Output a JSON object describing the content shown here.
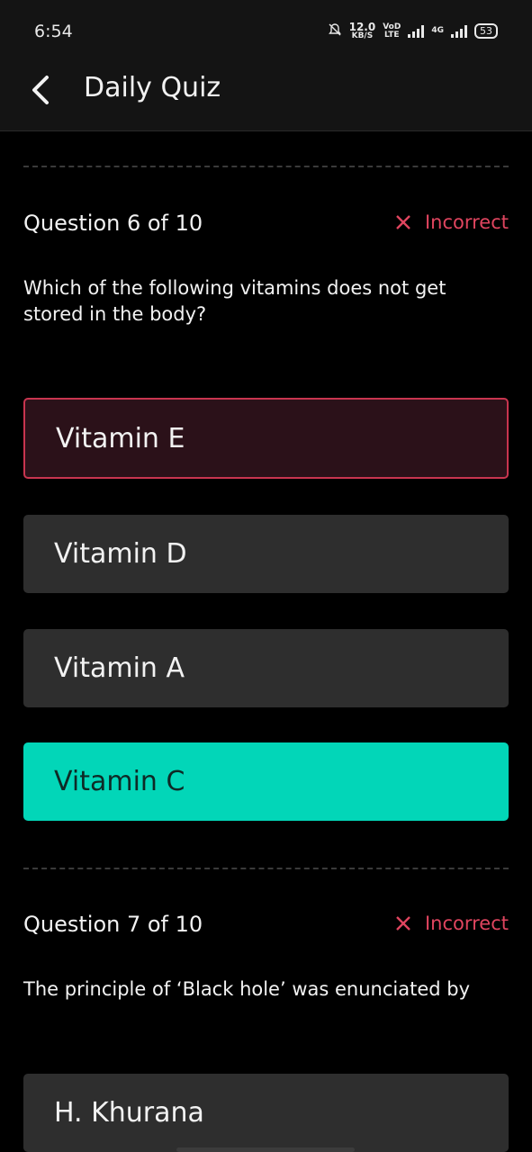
{
  "status_bar": {
    "time": "6:54",
    "net_speed_value": "12.0",
    "net_speed_unit": "KB/S",
    "carrier_top": "VoD",
    "carrier_bottom": "LTE",
    "network_type": "4G",
    "battery": "53"
  },
  "header": {
    "title": "Daily Quiz"
  },
  "questions": [
    {
      "number_label": "Question 6 of 10",
      "status": "Incorrect",
      "text": "Which of the following vitamins does not get stored in the body?",
      "options": [
        {
          "label": "Vitamin E",
          "state": "selected-wrong"
        },
        {
          "label": "Vitamin D",
          "state": "neutral"
        },
        {
          "label": "Vitamin A",
          "state": "neutral"
        },
        {
          "label": "Vitamin C",
          "state": "correct"
        }
      ]
    },
    {
      "number_label": "Question 7 of 10",
      "status": "Incorrect",
      "text": "The principle of ‘Black hole’ was enunciated by",
      "options": [
        {
          "label": "H. Khurana",
          "state": "neutral"
        }
      ]
    }
  ],
  "colors": {
    "background": "#000000",
    "incorrect": "#e0455f",
    "correct": "#02d6b8",
    "option_bg": "#2e2e2e",
    "wrong_option_bg": "#2b1119"
  },
  "icons": [
    "back-arrow-icon",
    "mute-bell-icon",
    "signal-icon",
    "incorrect-x-icon"
  ]
}
